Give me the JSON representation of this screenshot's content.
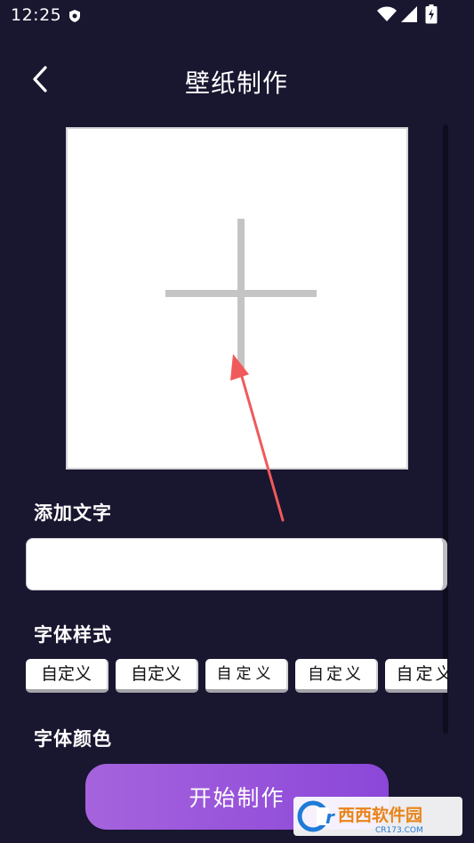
{
  "status_bar": {
    "time": "12:25"
  },
  "header": {
    "title": "壁纸制作"
  },
  "sections": {
    "add_text": "添加文字",
    "font_style": "字体样式",
    "font_color": "字体颜色"
  },
  "text_input": {
    "value": "",
    "placeholder": ""
  },
  "font_styles": [
    {
      "label": "自定义"
    },
    {
      "label": "自定义"
    },
    {
      "label": "自定义"
    },
    {
      "label": "自定义"
    },
    {
      "label": "自定义"
    }
  ],
  "start_button": {
    "label": "开始制作"
  },
  "watermark": {
    "brand": "西西软件园",
    "domain": "CR173.COM"
  },
  "colors": {
    "background": "#191630",
    "button_gradient_start": "#a663dd",
    "button_gradient_end": "#8b47d8",
    "annotation_arrow": "#f05a5a"
  },
  "icons": {
    "back": "chevron-left-icon",
    "add": "plus-icon",
    "status": [
      "shield-icon",
      "wifi-icon",
      "signal-icon",
      "battery-icon"
    ]
  }
}
